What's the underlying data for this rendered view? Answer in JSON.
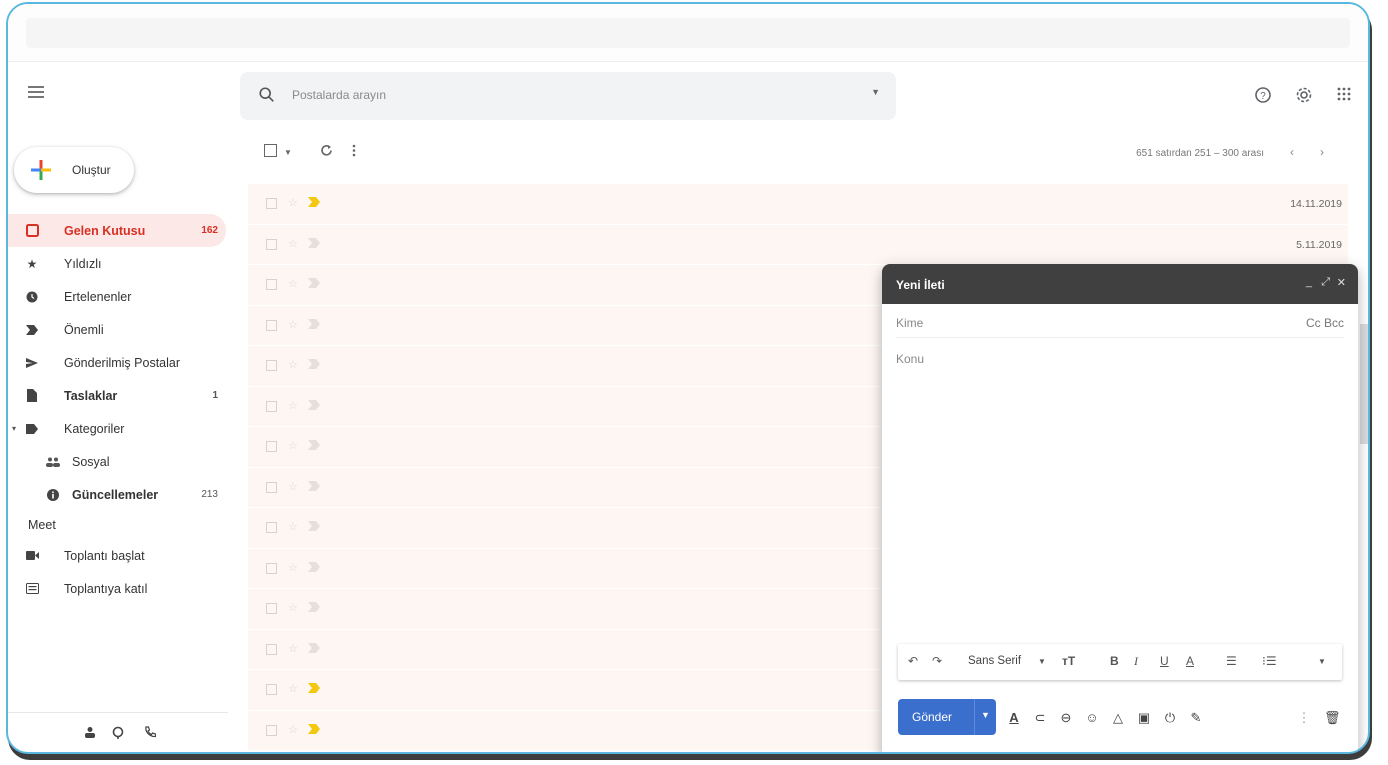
{
  "header": {
    "search_placeholder": "Postalarda arayın"
  },
  "sidebar": {
    "compose_label": "Oluştur",
    "items": [
      {
        "label": "Gelen Kutusu",
        "count": "162",
        "icon": "inbox-icon"
      },
      {
        "label": "Yıldızlı",
        "count": "",
        "icon": "star-icon"
      },
      {
        "label": "Ertelenenler",
        "count": "",
        "icon": "clock-icon"
      },
      {
        "label": "Önemli",
        "count": "",
        "icon": "important-icon"
      },
      {
        "label": "Gönderilmiş Postalar",
        "count": "",
        "icon": "send-icon"
      },
      {
        "label": "Taslaklar",
        "count": "1",
        "icon": "draft-icon"
      },
      {
        "label": "Kategoriler",
        "count": "",
        "icon": "label-icon"
      },
      {
        "label": "Sosyal",
        "count": "",
        "icon": "people-icon"
      },
      {
        "label": "Güncellemeler",
        "count": "213",
        "icon": "info-icon"
      }
    ],
    "meet_heading": "Meet",
    "meet_items": [
      {
        "label": "Toplantı başlat",
        "icon": "video-icon"
      },
      {
        "label": "Toplantıya katıl",
        "icon": "keyboard-icon"
      }
    ]
  },
  "toolbar": {
    "pager_text": "651 satırdan 251 – 300 arası"
  },
  "emails": [
    {
      "date": "14.11.2019",
      "important": true
    },
    {
      "date": "5.11.2019",
      "important": false
    },
    {
      "date": "",
      "important": false
    },
    {
      "date": "",
      "important": false
    },
    {
      "date": "",
      "important": false
    },
    {
      "date": "",
      "important": false
    },
    {
      "date": "",
      "important": false
    },
    {
      "date": "",
      "important": false
    },
    {
      "date": "",
      "important": false
    },
    {
      "date": "",
      "important": false
    },
    {
      "date": "",
      "important": false
    },
    {
      "date": "",
      "important": false
    },
    {
      "date": "",
      "important": true
    },
    {
      "date": "",
      "important": true
    }
  ],
  "compose": {
    "title": "Yeni İleti",
    "to_label": "Kime",
    "cc_bcc_label": "Cc Bcc",
    "subject_label": "Konu",
    "font_label": "Sans Serif",
    "send_label": "Gönder"
  },
  "colors": {
    "accent_red": "#d93025",
    "send_blue": "#3b6fce",
    "important_yellow": "#f2c811"
  }
}
